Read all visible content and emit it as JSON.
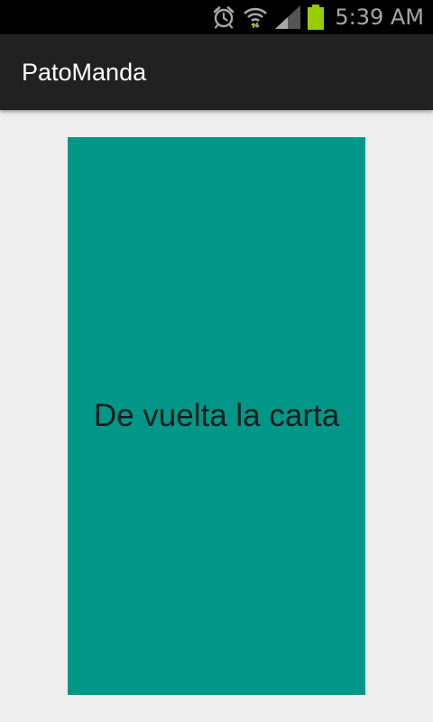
{
  "status_bar": {
    "time": "5:39 AM",
    "icons": [
      "alarm-icon",
      "wifi-icon",
      "signal-icon",
      "battery-icon"
    ],
    "battery_color": "#99cc00",
    "icon_color": "#a7a7a7"
  },
  "app_bar": {
    "title": "PatoManda",
    "background": "#212121"
  },
  "card": {
    "label": "De vuelta la carta",
    "background": "#009688"
  }
}
